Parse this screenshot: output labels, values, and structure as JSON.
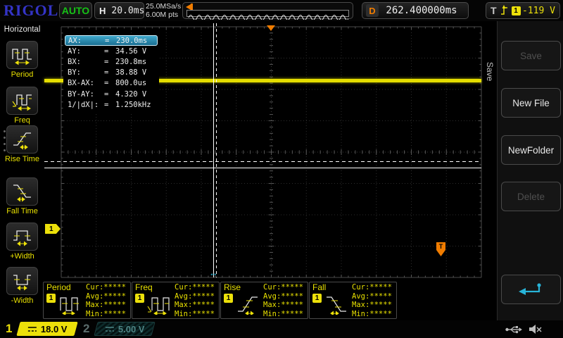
{
  "colors": {
    "accent_yellow": "#ece00a",
    "accent_orange": "#f07c00",
    "accent_green": "#16c216",
    "accent_cyan": "#28b4d8",
    "logo_blue": "#3434c6",
    "highlight_blue": "#2a8cb4",
    "ch2_teal": "#4e8585"
  },
  "top_bar": {
    "logo": "RIGOL",
    "status": "AUTO",
    "h_label": "H",
    "timebase": "20.0ms",
    "sample_rate": "25.0MSa/s",
    "memory_depth": "6.00M pts",
    "delay_label": "D",
    "delay_value": "262.400000ms",
    "trigger_label": "T",
    "trigger_source": "1",
    "trigger_level": "-119 V"
  },
  "left_menu": {
    "title": "Horizontal",
    "items": [
      {
        "label": "Period",
        "icon": "period-icon"
      },
      {
        "label": "Freq",
        "icon": "freq-icon"
      },
      {
        "label": "Rise Time",
        "icon": "rise-time-icon"
      },
      {
        "label": "Fall Time",
        "icon": "fall-time-icon"
      },
      {
        "label": "+Width",
        "icon": "pos-width-icon"
      },
      {
        "label": "-Width",
        "icon": "neg-width-icon"
      }
    ]
  },
  "cursor_readout": {
    "rows": [
      {
        "label": "AX:",
        "eq": "=",
        "value": "230.0ms"
      },
      {
        "label": "AY:",
        "eq": "=",
        "value": "34.56 V"
      },
      {
        "label": "BX:",
        "eq": "=",
        "value": "230.8ms"
      },
      {
        "label": "BY:",
        "eq": "=",
        "value": "38.88 V"
      },
      {
        "label": "BX-AX:",
        "eq": "=",
        "value": "800.0us"
      },
      {
        "label": "BY-AY:",
        "eq": "=",
        "value": "4.320 V"
      },
      {
        "label": "1/|dX|:",
        "eq": "=",
        "value": "1.250kHz"
      }
    ]
  },
  "right_menu": {
    "tab_label": "Save",
    "buttons": [
      {
        "label": "Save",
        "enabled": false
      },
      {
        "label": "New File",
        "enabled": true
      },
      {
        "label": "NewFolder",
        "enabled": true
      },
      {
        "label": "Delete",
        "enabled": false
      }
    ],
    "enter_icon": "enter-arrow-icon"
  },
  "display": {
    "trigger_marker_label": "T",
    "ch1_marker_label": "1",
    "cursor_drag_glyph": "↔"
  },
  "measurements": [
    {
      "title": "Period",
      "channel": "1",
      "icon": "period-icon",
      "stats": [
        "Cur:*****",
        "Avg:*****",
        "Max:*****",
        "Min:*****"
      ]
    },
    {
      "title": "Freq",
      "channel": "1",
      "icon": "freq-icon",
      "stats": [
        "Cur:*****",
        "Avg:*****",
        "Max:*****",
        "Min:*****"
      ]
    },
    {
      "title": "Rise",
      "channel": "1",
      "icon": "rise-time-icon",
      "stats": [
        "Cur:*****",
        "Avg:*****",
        "Max:*****",
        "Min:*****"
      ]
    },
    {
      "title": "Fall",
      "channel": "1",
      "icon": "fall-time-icon",
      "stats": [
        "Cur:*****",
        "Avg:*****",
        "Max:*****",
        "Min:*****"
      ]
    }
  ],
  "channels": [
    {
      "number": "1",
      "scale": "18.0 V",
      "active": true
    },
    {
      "number": "2",
      "scale": "5.00 V",
      "active": false
    }
  ],
  "status_icons": [
    "usb-icon",
    "speaker-muted-icon"
  ]
}
